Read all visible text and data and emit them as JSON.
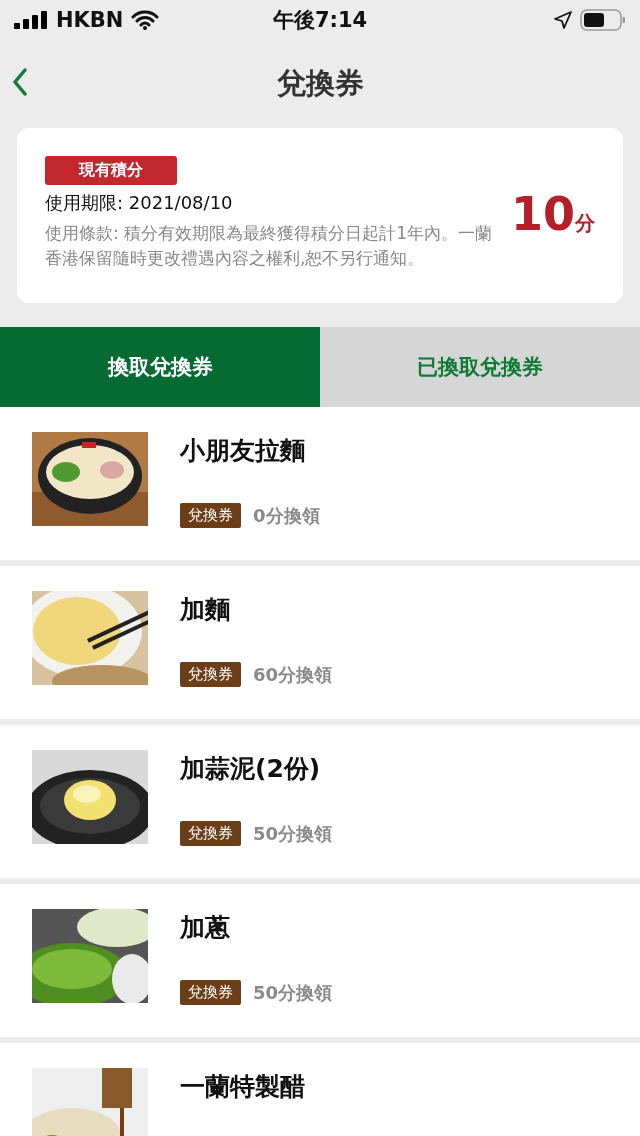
{
  "status_bar": {
    "carrier": "HKBN",
    "time": "午後7:14"
  },
  "nav": {
    "title": "兌換券"
  },
  "points_card": {
    "badge": "現有積分",
    "expiry": "使用期限: 2021/08/10",
    "terms": "使用條款: 積分有效期限為最終獲得積分日起計1年內。一蘭香港保留隨時更改禮遇內容之權利,恕不另行通知。",
    "points": "10",
    "unit": "分"
  },
  "tabs": [
    {
      "label": "換取兌換券",
      "selected": true
    },
    {
      "label": "已換取兌換券",
      "selected": false
    }
  ],
  "vouchers": [
    {
      "name": "小朋友拉麵",
      "tag": "兌換券",
      "cost": "0分換領",
      "kind": "picture"
    },
    {
      "name": "加麵",
      "tag": "兌換券",
      "cost": "60分換領",
      "kind": "picture"
    },
    {
      "name": "加蒜泥(2份)",
      "tag": "兌換券",
      "cost": "50分換領",
      "kind": "picture"
    },
    {
      "name": "加蔥",
      "tag": "兌換券",
      "cost": "50分換領",
      "kind": "picture"
    },
    {
      "name": "一蘭特製醋",
      "kind": "picture"
    }
  ]
}
